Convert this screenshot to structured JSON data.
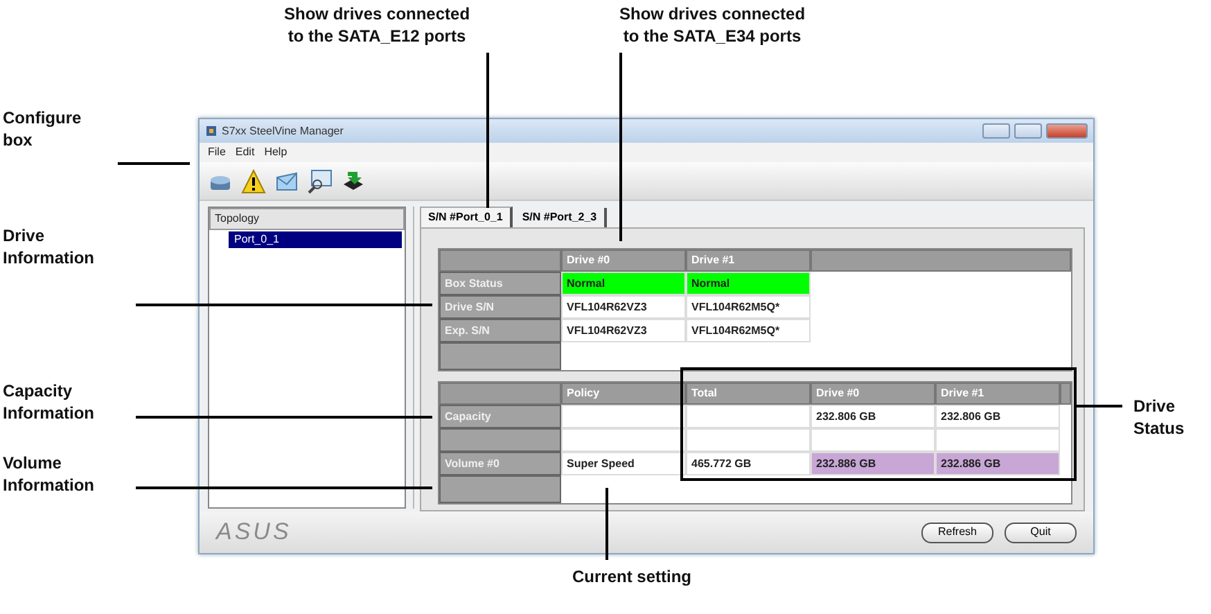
{
  "window": {
    "title": "S7xx SteelVine Manager"
  },
  "menu": [
    "File",
    "Edit",
    "Help"
  ],
  "topology": {
    "header": "Topology",
    "items": [
      {
        "label": "Port_0_1",
        "selected": true
      }
    ]
  },
  "tabs": [
    {
      "label": "S/N #Port_0_1",
      "selected": true
    },
    {
      "label": "S/N #Port_2_3",
      "selected": false
    }
  ],
  "drive_table": {
    "columns": [
      "Drive #0",
      "Drive #1"
    ],
    "rows": [
      {
        "label": "Box Status",
        "cells": [
          {
            "text": "Normal",
            "color": "#00ff00"
          },
          {
            "text": "Normal",
            "color": "#00ff00"
          }
        ]
      },
      {
        "label": "Drive S/N",
        "cells": [
          {
            "text": "VFL104R62VZ3"
          },
          {
            "text": "VFL104R62M5Q*"
          }
        ]
      },
      {
        "label": "Exp. S/N",
        "cells": [
          {
            "text": "VFL104R62VZ3"
          },
          {
            "text": "VFL104R62M5Q*"
          }
        ]
      }
    ]
  },
  "capacity_table": {
    "columns": [
      "Policy",
      "Total",
      "Drive #0",
      "Drive #1"
    ],
    "rows": [
      {
        "label": "Capacity",
        "cells": [
          {},
          {},
          {
            "text": "232.806 GB"
          },
          {
            "text": "232.806 GB"
          }
        ]
      },
      {
        "cells": [
          {},
          {},
          {},
          {}
        ]
      },
      {
        "label": "Volume #0",
        "cells": [
          {
            "text": "Super Speed"
          },
          {
            "text": "465.772 GB"
          },
          {
            "text": "232.886 GB",
            "color": "#c8a6d6"
          },
          {
            "text": "232.886 GB",
            "color": "#c8a6d6"
          }
        ]
      }
    ]
  },
  "logo": "ASUS",
  "buttons": [
    "Refresh",
    "Quit"
  ],
  "callouts": [
    {
      "lines": [
        "Show drives connected",
        "to the SATA_E12 ports"
      ]
    },
    {
      "lines": [
        "Show drives connected",
        "to the SATA_E34 ports"
      ]
    },
    {
      "lines": [
        "Configure",
        "box"
      ]
    },
    {
      "lines": [
        "Drive",
        "Information"
      ]
    },
    {
      "lines": [
        "Capacity",
        "Information"
      ]
    },
    {
      "lines": [
        "Volume",
        "Information"
      ]
    },
    {
      "lines": [
        "Drive",
        "Status"
      ]
    },
    {
      "lines": [
        "Current setting"
      ]
    }
  ]
}
